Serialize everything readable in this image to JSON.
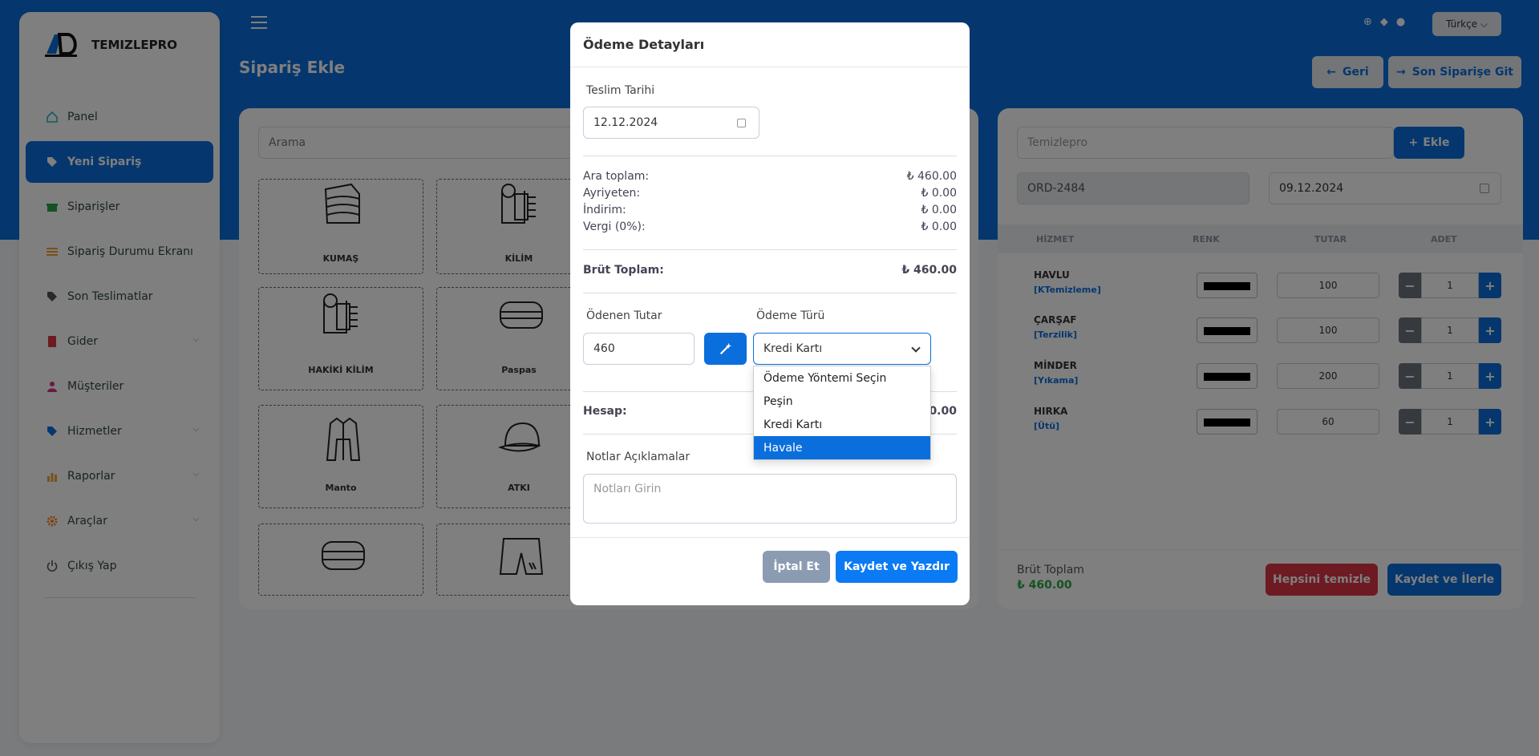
{
  "app": {
    "name": "TEMIZLEPRO"
  },
  "header": {
    "page_title": "Sipariş Ekle",
    "language": "Türkçe ⌵",
    "back_label": "Geri",
    "last_order_label": "Son Siparişe Git"
  },
  "sidebar": {
    "items": [
      {
        "label": "Panel"
      },
      {
        "label": "Yeni Sipariş"
      },
      {
        "label": "Siparişler"
      },
      {
        "label": "Sipariş Durumu Ekranı"
      },
      {
        "label": "Son Teslimatlar"
      },
      {
        "label": "Gider"
      },
      {
        "label": "Müşteriler"
      },
      {
        "label": "Hizmetler"
      },
      {
        "label": "Raporlar"
      },
      {
        "label": "Araçlar"
      },
      {
        "label": "Çıkış Yap"
      }
    ]
  },
  "products": {
    "search_placeholder": "Arama",
    "tiles": [
      {
        "label": "KUMAŞ"
      },
      {
        "label": "KİLİM"
      },
      {
        "label": "HAKİKİ KİLİM"
      },
      {
        "label": "Paspas"
      },
      {
        "label": "Manto"
      },
      {
        "label": "ATKI"
      }
    ]
  },
  "order": {
    "company_placeholder": "Temizlepro",
    "add_label": "Ekle",
    "order_no": "ORD-2484",
    "order_date": "09.12.2024",
    "columns": {
      "service": "HİZMET",
      "color": "RENK",
      "amount": "TUTAR",
      "qty": "ADET"
    },
    "rows": [
      {
        "name": "HAVLU",
        "category": "[KTemizleme]",
        "price": "100",
        "qty": "1"
      },
      {
        "name": "ÇARŞAF",
        "category": "[Terzilik]",
        "price": "100",
        "qty": "1"
      },
      {
        "name": "MİNDER",
        "category": "[Yıkama]",
        "price": "200",
        "qty": "1"
      },
      {
        "name": "HIRKA",
        "category": "[Ütü]",
        "price": "60",
        "qty": "1"
      }
    ],
    "gross_label": "Brüt Toplam",
    "gross_value": "₺ 460.00",
    "clear_label": "Hepsini temizle",
    "save_next_label": "Kaydet ve İlerle"
  },
  "modal": {
    "title": "Ödeme Detayları",
    "delivery_label": "Teslim Tarihi",
    "delivery_date": "12.12.2024",
    "summary": {
      "subtotal_label": "Ara toplam:",
      "subtotal": "₺ 460.00",
      "extra_label": "Ayriyeten:",
      "extra": "₺ 0.00",
      "discount_label": "İndirim:",
      "discount": "₺ 0.00",
      "tax_label": "Vergi (0%):",
      "tax": "₺ 0.00"
    },
    "gross_label": "Brüt Toplam:",
    "gross_value": "₺ 460.00",
    "paid_label": "Ödenen Tutar",
    "paid_value": "460",
    "payment_type_label": "Ödeme Türü",
    "payment_selected": "Kredi Kartı",
    "payment_options": [
      "Ödeme Yöntemi Seçin",
      "Peşin",
      "Kredi Kartı",
      "Havale"
    ],
    "highlighted_option": "Havale",
    "account_label": "Hesap:",
    "account_value_partial": "60.00",
    "notes_label": "Notlar Açıklamalar",
    "notes_placeholder": "Notları Girin",
    "cancel_label": "İptal Et",
    "save_print_label": "Kaydet ve Yazdır"
  },
  "colors": {
    "primary": "#0a6fdc",
    "danger": "#dc3545",
    "success": "#28a745",
    "muted_button": "#8a9bb2"
  }
}
